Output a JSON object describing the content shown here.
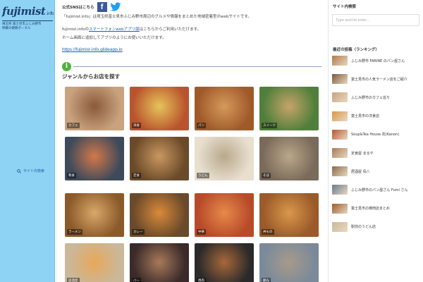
{
  "logo": {
    "name": "fujimist",
    "suffix": ".info",
    "tagline_line1": "埼玉県 富士見市ふじみ野市",
    "tagline_line2": "明確の鍵数ポータル"
  },
  "left_sidebar": {
    "search_label": "サイト内検索"
  },
  "main": {
    "sns_label": "公式SNSはこちら",
    "intro_line1": "「fujimist.info」は埼玉県富士見市ふじみ野市周辺のグルメや情報をまとめた地域密着型のwebサイトです。",
    "intro_line2_pre": "fujimist.infoの",
    "intro_line2_link": "スマートフォンwebアプリ版",
    "intro_line2_post": "はこちらからご利用いただけます。",
    "intro_line3": "ホーム画面に追加してアプリのようにお使いいただけます。",
    "site_link": "https://fujimist-info.glideapp.io",
    "section_title": "ジャンルからお店を探す",
    "tiles": [
      {
        "label": "カフェ",
        "colors": [
          "#c9a27e",
          "#8a5a3a"
        ]
      },
      {
        "label": "洋食",
        "colors": [
          "#b9552e",
          "#e6c45a"
        ]
      },
      {
        "label": "パン",
        "colors": [
          "#a05a2a",
          "#d49a5b"
        ]
      },
      {
        "label": "スイーツ",
        "colors": [
          "#4f7f3a",
          "#c7a36b"
        ]
      },
      {
        "label": "和食",
        "colors": [
          "#3e4a5a",
          "#d4784a"
        ]
      },
      {
        "label": "定食",
        "colors": [
          "#6b4a2a",
          "#c99860"
        ]
      },
      {
        "label": "うどん",
        "colors": [
          "#e8dfcf",
          "#b8a98c"
        ]
      },
      {
        "label": "そば",
        "colors": [
          "#7a6a5a",
          "#b9a88a"
        ]
      },
      {
        "label": "ラーメン",
        "colors": [
          "#8a5a2a",
          "#d9a86a"
        ]
      },
      {
        "label": "カレー",
        "colors": [
          "#6a4a2a",
          "#d98a3a"
        ]
      },
      {
        "label": "中華",
        "colors": [
          "#b84a2a",
          "#e68a4a"
        ]
      },
      {
        "label": "丼もの",
        "colors": [
          "#9a5a2a",
          "#d9984a"
        ]
      },
      {
        "label": "居酒屋",
        "colors": [
          "#c9b89a",
          "#e8a85a"
        ]
      },
      {
        "label": "バー",
        "colors": [
          "#3a2a2a",
          "#a87a5a"
        ]
      },
      {
        "label": "焼肉",
        "colors": [
          "#2a2a2a",
          "#a8683a"
        ]
      },
      {
        "label": "観光",
        "colors": [
          "#7a8a9a",
          "#a89a8a"
        ]
      }
    ]
  },
  "right_sidebar": {
    "search_heading": "サイト内検索",
    "search_placeholder": "Type and hit enter...",
    "recent_heading": "最近の投稿（ランキング）",
    "items": [
      {
        "label": "ふじみ野市 FARINE のパン屋さん",
        "color": "#b07a4a"
      },
      {
        "label": "富士見市の人気ラーメン店をご紹介",
        "color": "#7a5a3a"
      },
      {
        "label": "ふじみ野市のカフェ巡り",
        "color": "#c9a27e"
      },
      {
        "label": "富士見市の洋食店",
        "color": "#d9984a"
      },
      {
        "label": "Soup&Tea House 花(Kanon)",
        "color": "#b9552e"
      },
      {
        "label": "定食屋 まるや",
        "color": "#a87a5a"
      },
      {
        "label": "居酒屋 鳥八",
        "color": "#8a6a4a"
      },
      {
        "label": "ふじみ野市のパン屋さん Fumi さん",
        "color": "#6a7a8a"
      },
      {
        "label": "富士見市の焼肉店まとめ",
        "color": "#9a5a2a"
      },
      {
        "label": "駅前のうどん店",
        "color": "#c9b89a"
      }
    ]
  }
}
